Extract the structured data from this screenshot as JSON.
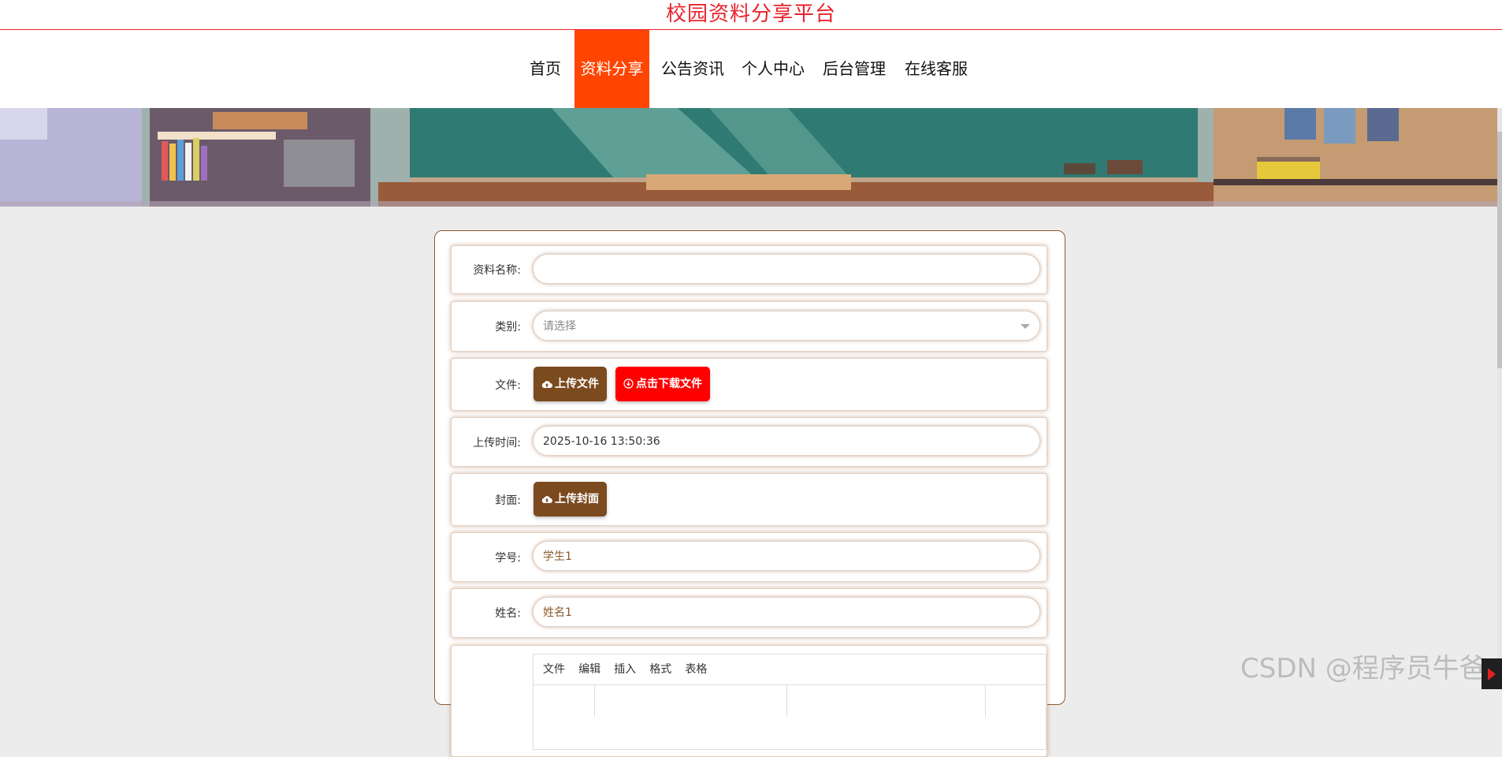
{
  "site": {
    "title": "校园资料分享平台"
  },
  "nav": {
    "items": [
      {
        "label": "首页"
      },
      {
        "label": "资料分享"
      },
      {
        "label": "公告资讯"
      },
      {
        "label": "个人中心"
      },
      {
        "label": "后台管理"
      },
      {
        "label": "在线客服"
      }
    ],
    "active_index": 1
  },
  "form": {
    "name": {
      "label": "资料名称:",
      "value": ""
    },
    "category": {
      "label": "类别:",
      "placeholder": "请选择"
    },
    "file": {
      "label": "文件:",
      "upload_label": "上传文件",
      "download_label": "点击下载文件"
    },
    "upload_time": {
      "label": "上传时间:",
      "value": "2025-10-16 13:50:36"
    },
    "cover": {
      "label": "封面:",
      "upload_label": "上传封面"
    },
    "student_id": {
      "label": "学号:",
      "value": "学生1"
    },
    "student_name": {
      "label": "姓名:",
      "value": "姓名1"
    },
    "editor": {
      "menu": [
        "文件",
        "编辑",
        "插入",
        "格式",
        "表格"
      ]
    }
  },
  "watermark": "CSDN @程序员牛爸",
  "colors": {
    "title": "#e8232d",
    "nav_active": "#ff4500",
    "brown_button": "#7b4a1e",
    "red_button": "#ff0000",
    "card_border": "#8a5a2b"
  }
}
